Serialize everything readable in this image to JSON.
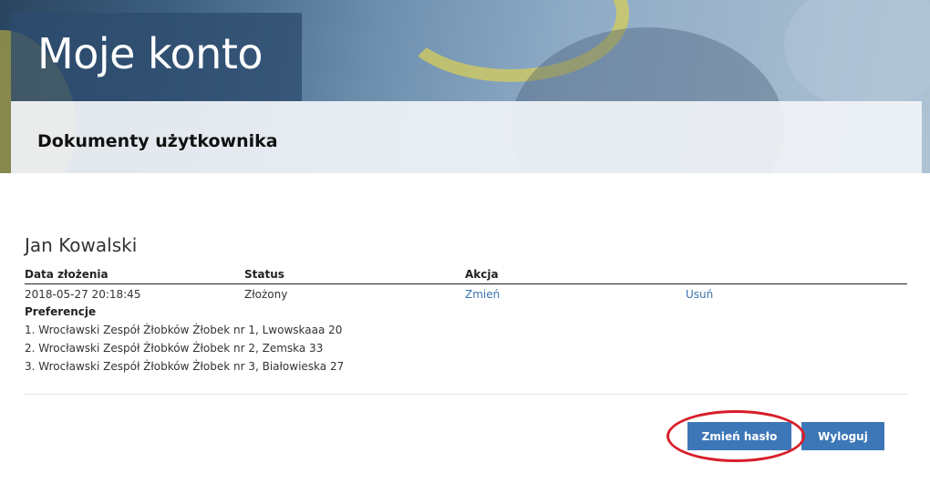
{
  "header": {
    "title": "Moje konto",
    "subtitle": "Dokumenty użytkownika"
  },
  "user": {
    "name": "Jan Kowalski"
  },
  "table": {
    "columns": [
      "Data złożenia",
      "Status",
      "Akcja",
      ""
    ],
    "rows": [
      {
        "date": "2018-05-27 20:18:45",
        "status": "Złożony",
        "action_edit": "Zmień",
        "action_delete": "Usuń"
      }
    ]
  },
  "preferences": {
    "label": "Preferencje",
    "items": [
      "1. Wrocławski Zespół Żłobków Żłobek nr 1, Lwowskaaa 20",
      "2. Wrocławski Zespół Żłobków Żłobek nr 2, Zemska 33",
      "3. Wrocławski Zespół Żłobków Żłobek nr 3, Białowieska 27"
    ]
  },
  "buttons": {
    "change_password": "Zmień hasło",
    "logout": "Wyloguj"
  },
  "colors": {
    "primary_button": "#3e77b7",
    "link": "#3a75b0",
    "highlight": "#d81e2a"
  }
}
